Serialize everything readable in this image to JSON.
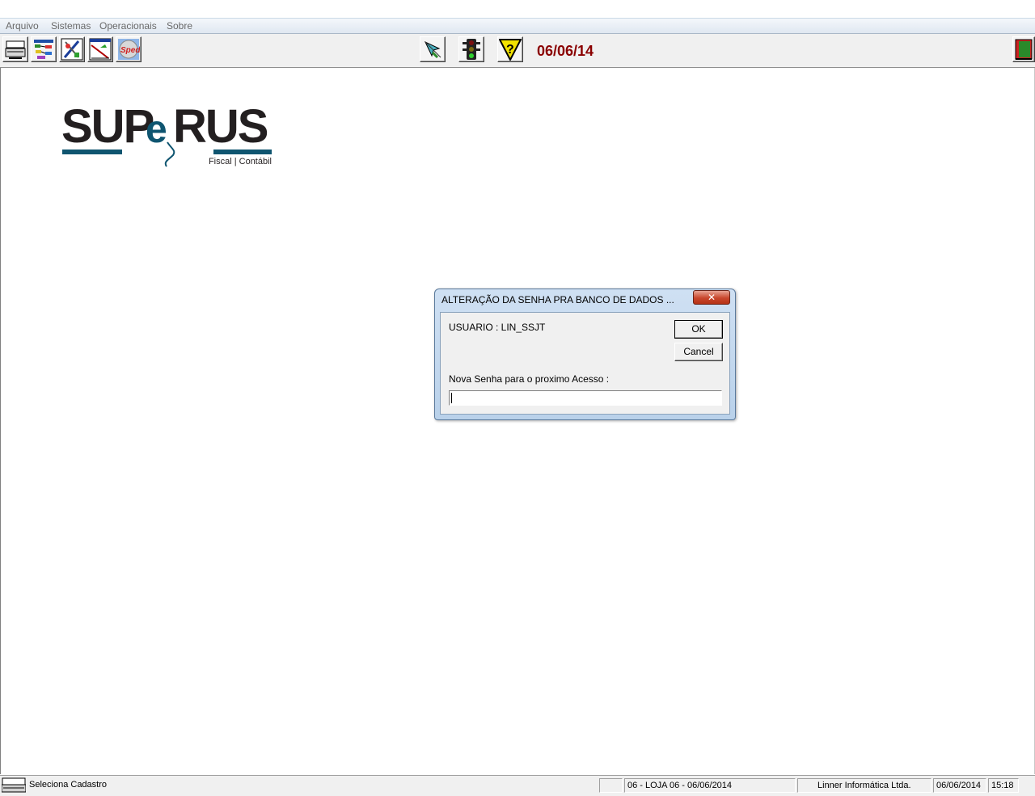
{
  "menu": {
    "items": [
      "Arquivo",
      "Sistemas",
      "Operacionais",
      "Sobre"
    ]
  },
  "toolbar": {
    "buttons": [
      {
        "icon": "keyboard-printer-icon"
      },
      {
        "icon": "flowchart-icon"
      },
      {
        "icon": "tools-icon"
      },
      {
        "icon": "chart-window-icon"
      },
      {
        "icon": "sped-icon",
        "label": "Sped"
      },
      {
        "icon": "mouse-pointer-icon"
      },
      {
        "icon": "traffic-light-icon"
      },
      {
        "icon": "help-question-icon"
      },
      {
        "icon": "exit-door-icon"
      }
    ],
    "date": "06/06/14"
  },
  "logo": {
    "brand": "SUPERUS",
    "tagline": "Fiscal | Contábil",
    "colors": {
      "text": "#231f20",
      "accent": "#0f5570"
    }
  },
  "dialog": {
    "title": "ALTERAÇÃO DA SENHA PRA BANCO DE DADOS ...",
    "user_label": "USUARIO : LIN_SSJT",
    "password_label": "Nova Senha para o proximo Acesso :",
    "password_value": "",
    "ok_label": "OK",
    "cancel_label": "Cancel",
    "close_label": "x"
  },
  "statusbar": {
    "action": "Seleciona Cadastro",
    "empty": "",
    "store": "06 - LOJA 06 - 06/06/2014",
    "company": "Linner Informática Ltda.",
    "date": "06/06/2014",
    "time": "15:18"
  }
}
